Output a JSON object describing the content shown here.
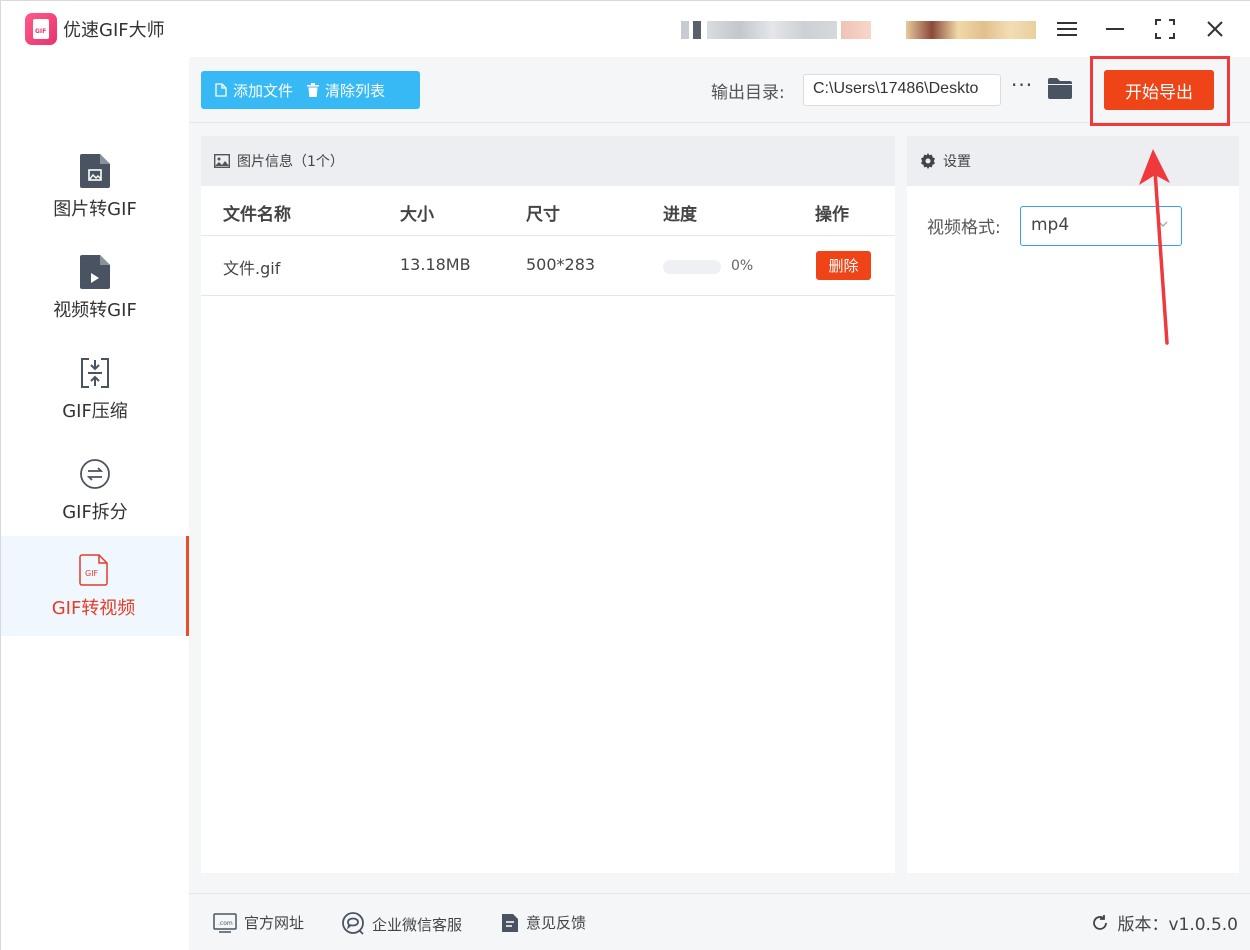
{
  "app": {
    "title": "优速GIF大师",
    "logo_text": "GIF"
  },
  "sidebar": {
    "items": [
      {
        "label": "图片转GIF",
        "icon": "image-file-icon"
      },
      {
        "label": "视频转GIF",
        "icon": "video-file-icon"
      },
      {
        "label": "GIF压缩",
        "icon": "compress-icon"
      },
      {
        "label": "GIF拆分",
        "icon": "split-icon"
      },
      {
        "label": "GIF转视频",
        "icon": "gif-file-icon",
        "active": true
      }
    ]
  },
  "toolbar": {
    "add_files": "添加文件",
    "clear_list": "清除列表",
    "output_label": "输出目录:",
    "output_path": "C:\\Users\\17486\\Deskto",
    "more": "···",
    "export": "开始导出"
  },
  "files": {
    "header": "图片信息（1个）",
    "columns": [
      "文件名称",
      "大小",
      "尺寸",
      "进度",
      "操作"
    ],
    "rows": [
      {
        "name": "文件.gif",
        "size": "13.18MB",
        "dimensions": "500*283",
        "progress": 0,
        "progress_text": "0%",
        "action": "删除"
      }
    ]
  },
  "settings": {
    "header": "设置",
    "format_label": "视频格式:",
    "format_value": "mp4"
  },
  "footer": {
    "website": "官方网址",
    "wechat": "企业微信客服",
    "feedback": "意见反馈",
    "version": "版本：v1.0.5.0"
  },
  "colors": {
    "accent": "#ee4417",
    "blue": "#37b9f5",
    "active_bg": "#f1f7fe",
    "annotation": "#f0393c"
  }
}
